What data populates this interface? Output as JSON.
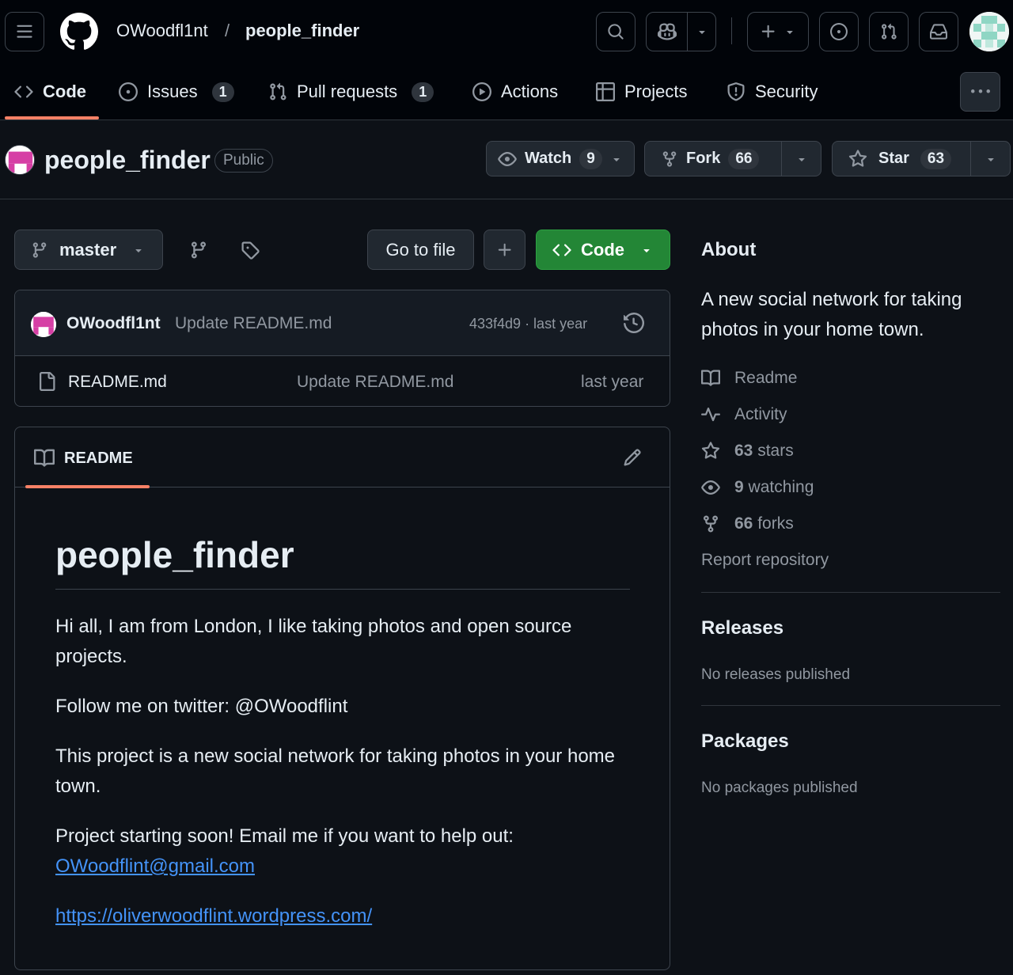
{
  "header": {
    "owner": "OWoodfl1nt",
    "separator": "/",
    "repo": "people_finder"
  },
  "tabs": [
    {
      "label": "Code",
      "icon": "code-icon",
      "selected": true
    },
    {
      "label": "Issues",
      "icon": "issue-opened-icon",
      "count": "1"
    },
    {
      "label": "Pull requests",
      "icon": "git-pull-request-icon",
      "count": "1"
    },
    {
      "label": "Actions",
      "icon": "play-icon"
    },
    {
      "label": "Projects",
      "icon": "table-icon"
    },
    {
      "label": "Security",
      "icon": "shield-icon"
    }
  ],
  "repo_header": {
    "name": "people_finder",
    "visibility": "Public",
    "watch": {
      "label": "Watch",
      "count": "9"
    },
    "fork": {
      "label": "Fork",
      "count": "66"
    },
    "star": {
      "label": "Star",
      "count": "63"
    }
  },
  "toolbar": {
    "branch": "master",
    "go_to_file": "Go to file",
    "code_button": "Code"
  },
  "latest_commit": {
    "author": "OWoodfl1nt",
    "message": "Update README.md",
    "meta": "433f4d9 · last year"
  },
  "files": [
    {
      "name": "README.md",
      "message": "Update README.md",
      "time": "last year"
    }
  ],
  "readme": {
    "tab_label": "README",
    "title": "people_finder",
    "p1": "Hi all, I am from London, I like taking photos and open source projects.",
    "p2": "Follow me on twitter: @OWoodflint",
    "p3": "This project is a new social network for taking photos in your home town.",
    "p4_text": "Project starting soon! Email me if you want to help out:",
    "p4_link": "OWoodflint@gmail.com",
    "p5_link": "https://oliverwoodflint.wordpress.com/"
  },
  "about": {
    "heading": "About",
    "description": "A new social network for taking photos in your home town.",
    "readme": "Readme",
    "activity": "Activity",
    "stars_count": "63",
    "stars_label": "stars",
    "watching_count": "9",
    "watching_label": "watching",
    "forks_count": "66",
    "forks_label": "forks",
    "report": "Report repository"
  },
  "releases": {
    "heading": "Releases",
    "empty": "No releases published"
  },
  "packages": {
    "heading": "Packages",
    "empty": "No packages published"
  },
  "colors": {
    "bg": "#0d1117",
    "header_bg": "#010409",
    "accent_underline": "#f78166",
    "green_button": "#238636",
    "link": "#4493f8"
  }
}
